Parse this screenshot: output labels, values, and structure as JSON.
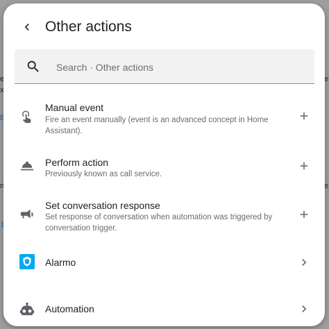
{
  "header": {
    "title": "Other actions"
  },
  "search": {
    "placeholder": "Search · Other actions",
    "value": ""
  },
  "items": [
    {
      "label": "Manual event",
      "description": "Fire an event manually (event is an advanced concept in Home Assistant).",
      "icon": "gesture-tap-icon",
      "trailing": "plus-icon"
    },
    {
      "label": "Perform action",
      "description": "Previously known as call service.",
      "icon": "room-service-bell-icon",
      "trailing": "plus-icon"
    },
    {
      "label": "Set conversation response",
      "description": "Set response of conversation when automation was triggered by conversation trigger.",
      "icon": "bullhorn-icon",
      "trailing": "plus-icon"
    },
    {
      "label": "Alarmo",
      "description": "",
      "icon": "alarmo-shield-icon",
      "trailing": "chevron-right-icon"
    },
    {
      "label": "Automation",
      "description": "",
      "icon": "robot-icon",
      "trailing": "chevron-right-icon"
    }
  ],
  "colors": {
    "icon": "#5f6368",
    "alarmo": "#03a9f4",
    "background": "#9e9e9e"
  },
  "backdrop": {
    "left_letter_1": "e",
    "left_letter_2": "x",
    "left_letter_3": "n",
    "right_letter_1": "e",
    "right_letter_2": "e",
    "link_1": "B",
    "link_2": "D"
  }
}
